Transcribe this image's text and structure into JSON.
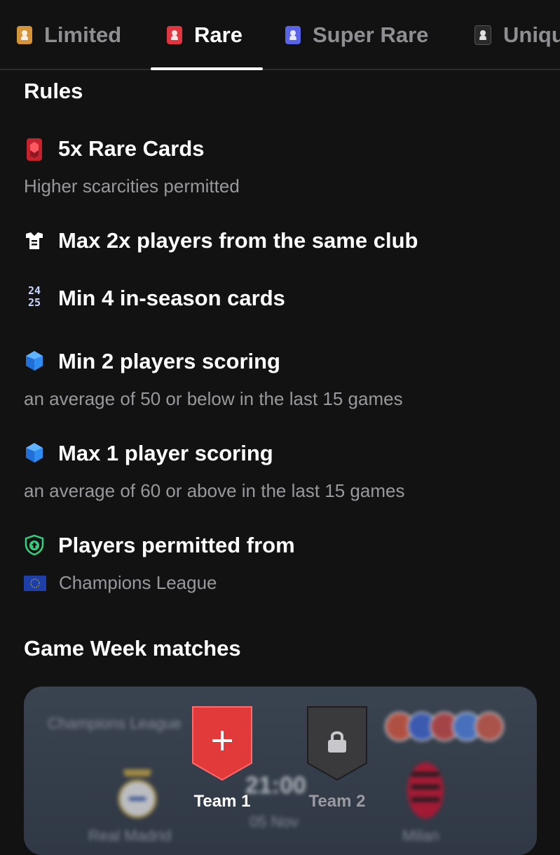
{
  "tabs": [
    {
      "label": "Limited",
      "color": "#d4943a",
      "active": false
    },
    {
      "label": "Rare",
      "color": "#e0363f",
      "active": true
    },
    {
      "label": "Super Rare",
      "color": "#5a64e8",
      "active": false
    },
    {
      "label": "Unique",
      "color": "#2a2a2a",
      "active": false
    }
  ],
  "rules": {
    "title": "Rules",
    "items": [
      {
        "icon": "rare-card-icon",
        "title": "5x Rare Cards",
        "subtitle": "Higher scarcities permitted"
      },
      {
        "icon": "jersey-icon",
        "title": "Max 2x players from the same club"
      },
      {
        "icon": "season-24-25-icon",
        "icon_text_top": "24",
        "icon_text_bottom": "25",
        "title": "Min 4 in-season cards"
      },
      {
        "icon": "blue-gem-icon",
        "title": "Min 2 players scoring",
        "subtitle": "an average of 50 or below in the last 15 games"
      },
      {
        "icon": "blue-gem-icon",
        "title": "Max 1 player scoring",
        "subtitle": "an average of 60 or above in the last 15 games"
      },
      {
        "icon": "shield-arrow-up-icon",
        "title": "Players permitted from",
        "league": "Champions League"
      }
    ]
  },
  "game_week": {
    "title": "Game Week matches",
    "card": {
      "competition": "Champions League",
      "home_team": "Real Madrid",
      "away_team": "Milan",
      "time": "21:00",
      "date": "05 Nov"
    },
    "team_slots": [
      {
        "label": "Team 1",
        "icon": "plus-icon",
        "color": "#e23a3a",
        "active": true
      },
      {
        "label": "Team 2",
        "icon": "lock-icon",
        "color": "#3a3a3c",
        "active": false
      }
    ]
  },
  "colors": {
    "background": "#121212",
    "rare": "#e0363f",
    "muted_text": "#98989d",
    "gem": "#2f8cf0",
    "shield": "#35d07f"
  }
}
